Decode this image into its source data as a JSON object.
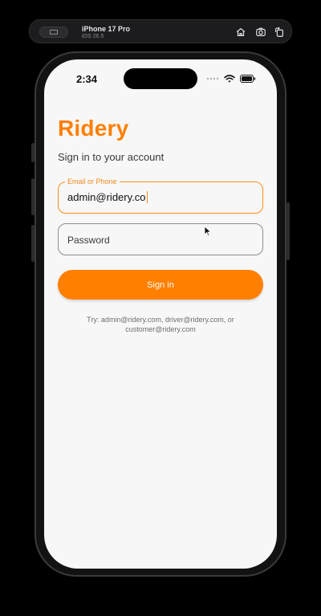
{
  "simulator": {
    "device_name": "iPhone 17 Pro",
    "os_version": "iOS 26.5",
    "icons": [
      "home-icon",
      "screenshot-icon",
      "rotate-icon"
    ]
  },
  "status_bar": {
    "time": "2:34",
    "icons": [
      "cellular-dots-icon",
      "wifi-icon",
      "battery-icon"
    ]
  },
  "app": {
    "brand": "Ridery",
    "subtitle": "Sign in to your account",
    "brand_color": "#ff7f00"
  },
  "form": {
    "email": {
      "label": "Email or Phone",
      "value": "admin@ridery.co"
    },
    "password": {
      "placeholder": "Password"
    },
    "submit_label": "Sign in"
  },
  "hint_text": "Try: admin@ridery.com, driver@ridery.com, or customer@ridery.com"
}
